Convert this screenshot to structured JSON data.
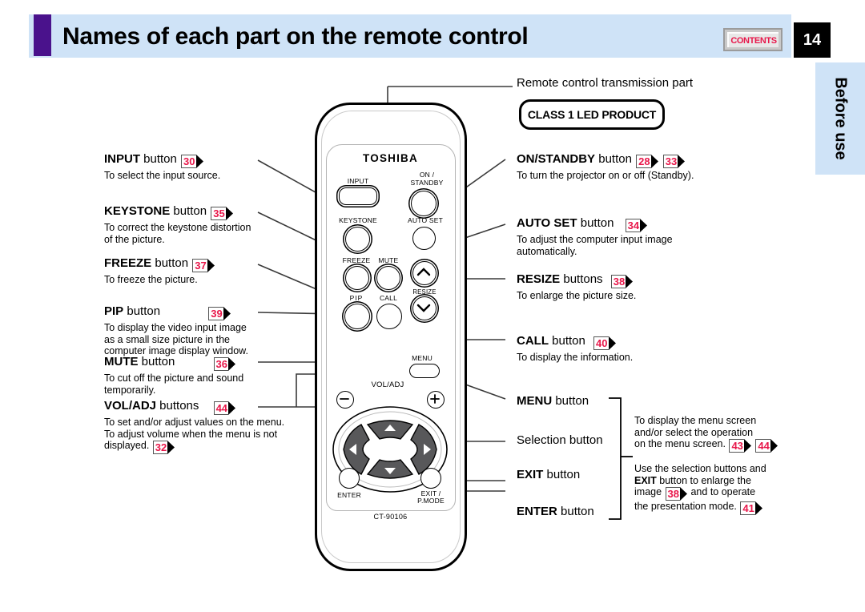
{
  "header": {
    "title": "Names of each part on the remote control",
    "contents_label": "CONTENTS",
    "page_number": "14",
    "side_tab": "Before use"
  },
  "remote": {
    "brand": "TOSHIBA",
    "model": "CT-90106",
    "button_labels": {
      "input": "INPUT",
      "on_standby": "ON /\nSTANDBY",
      "on_standby_line1": "ON /",
      "on_standby_line2": "STANDBY",
      "keystone": "KEYSTONE",
      "auto_set": "AUTO SET",
      "freeze": "FREEZE",
      "mute": "MUTE",
      "resize": "RESIZE",
      "pip": "PIP",
      "call": "CALL",
      "menu": "MENU",
      "vol_adj": "VOL/ADJ",
      "enter": "ENTER",
      "exit_line1": "EXIT /",
      "exit_line2": "P.MODE"
    }
  },
  "labels": {
    "transmission": "Remote control transmission part",
    "class_product": "CLASS 1 LED PRODUCT"
  },
  "callouts_left": [
    {
      "name": "input",
      "title_bold": "INPUT",
      "title_rest": " button",
      "refs": [
        "30"
      ],
      "desc": [
        "To select the input source."
      ]
    },
    {
      "name": "keystone",
      "title_bold": "KEYSTONE",
      "title_rest": " button",
      "refs": [
        "35"
      ],
      "desc": [
        "To correct the keystone distortion",
        "of the picture."
      ]
    },
    {
      "name": "freeze",
      "title_bold": "FREEZE",
      "title_rest": " button",
      "refs": [
        "37"
      ],
      "desc": [
        "To freeze the picture."
      ]
    },
    {
      "name": "pip",
      "title_bold": "PIP",
      "title_rest": " button",
      "refs": [
        "39"
      ],
      "desc": [
        "To display the video input image",
        "as a small size picture in the",
        "computer image display window."
      ]
    },
    {
      "name": "mute",
      "title_bold": "MUTE",
      "title_rest": " button",
      "refs": [
        "36"
      ],
      "desc": [
        "To cut off the picture and sound",
        "temporarily."
      ]
    },
    {
      "name": "vol-adj",
      "title_bold": "VOL/ADJ",
      "title_rest": " buttons",
      "refs": [
        "44"
      ],
      "desc": [
        "To set and/or adjust values on the menu.",
        "To adjust volume when the menu is not",
        "displayed."
      ],
      "trailing_ref": "32"
    }
  ],
  "callouts_right": [
    {
      "name": "on-standby",
      "title_bold": "ON/STANDBY",
      "title_rest": " button",
      "refs": [
        "28",
        "33"
      ],
      "desc": [
        "To turn the projector on or off (Standby)."
      ]
    },
    {
      "name": "auto-set",
      "title_bold": "AUTO SET",
      "title_rest": " button",
      "refs": [
        "34"
      ],
      "desc": [
        "To adjust the computer input image",
        "automatically."
      ]
    },
    {
      "name": "resize",
      "title_bold": "RESIZE",
      "title_rest": " buttons",
      "refs": [
        "38"
      ],
      "desc": [
        "To enlarge the picture size."
      ]
    },
    {
      "name": "call",
      "title_bold": "CALL",
      "title_rest": " button",
      "refs": [
        "40"
      ],
      "desc": [
        "To display the information."
      ]
    }
  ],
  "callouts_group": {
    "items": [
      {
        "name": "menu",
        "bold": "MENU",
        "rest": " button",
        "is_bold": true
      },
      {
        "name": "selection",
        "bold": "",
        "rest": "Selection button",
        "is_bold": false
      },
      {
        "name": "exit",
        "bold": "EXIT",
        "rest": " button",
        "is_bold": true
      },
      {
        "name": "enter",
        "bold": "ENTER",
        "rest": " button",
        "is_bold": true
      }
    ],
    "desc_top": [
      "To display the menu screen",
      "and/or select the operation",
      "on the menu screen."
    ],
    "desc_top_refs": [
      "43",
      "44"
    ],
    "desc_bottom_l1_a": "Use the selection buttons and",
    "desc_bottom_l2_bold": "EXIT",
    "desc_bottom_l2_rest": " button to enlarge the",
    "desc_bottom_l3_a": "image",
    "desc_bottom_l3_ref": "38",
    "desc_bottom_l3_b": "and to operate",
    "desc_bottom_l4_a": "the presentation mode.",
    "desc_bottom_l4_ref": "41"
  },
  "colors": {
    "band": "#cfe3f7",
    "accent_bar": "#4a128c",
    "ref_red": "#e8174a",
    "page_box": "#000000"
  }
}
